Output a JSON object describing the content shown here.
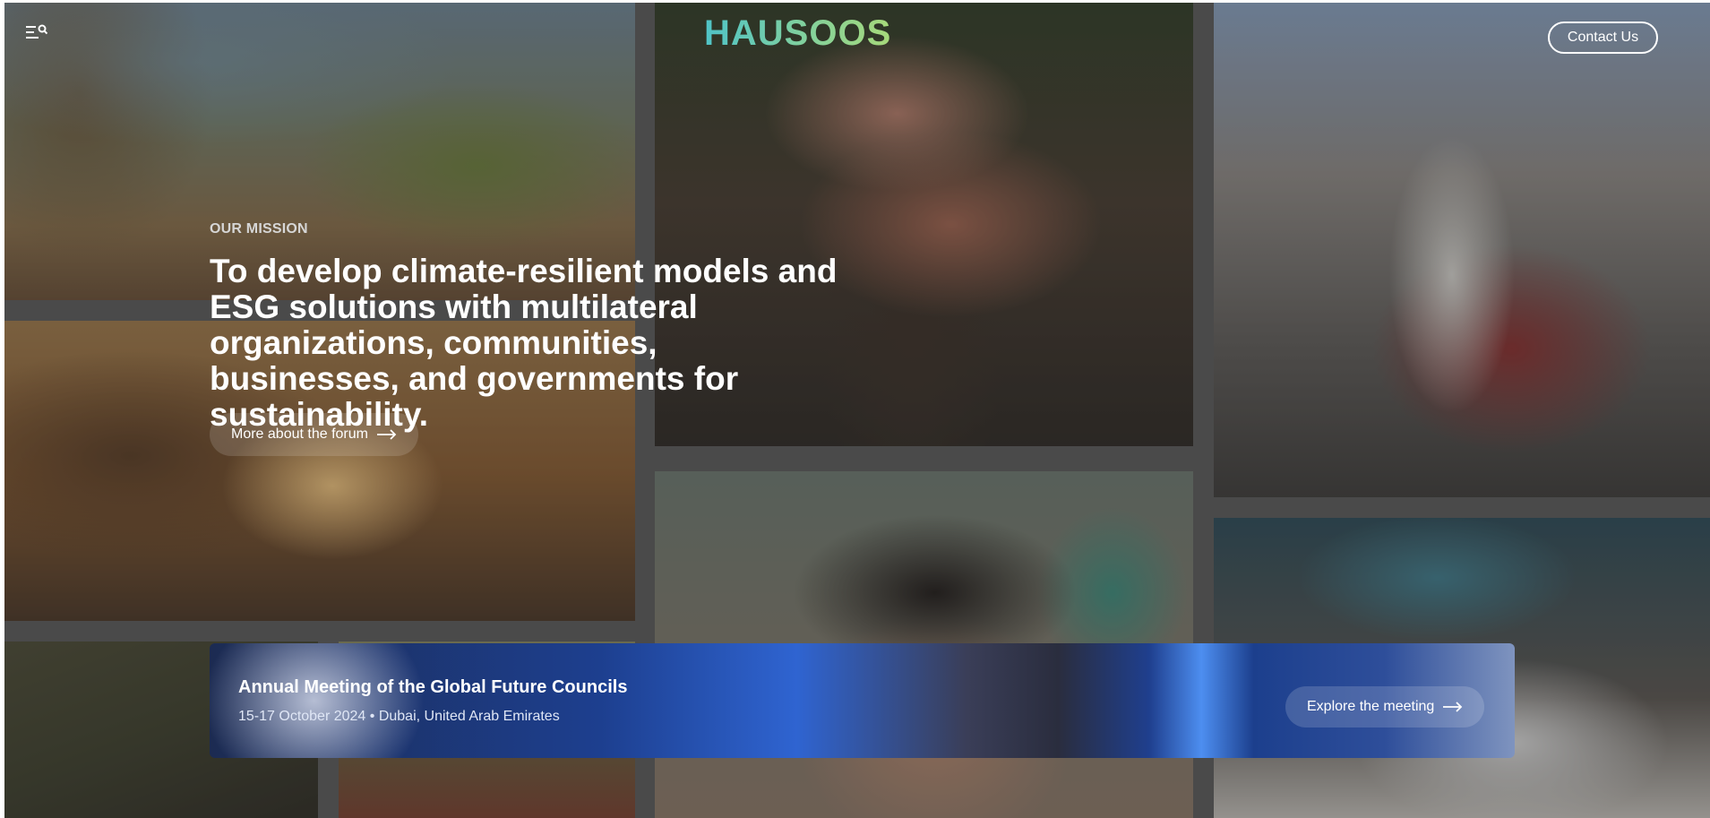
{
  "header": {
    "brand": "HAUSOOS",
    "contact_label": "Contact Us",
    "menu_icon": "menu-search-icon"
  },
  "mission": {
    "eyebrow": "OUR MISSION",
    "title": "To develop climate-resilient models and ESG solutions with multilateral organizations, communities, businesses, and governments for sustainability.",
    "cta_label": "More about the forum"
  },
  "event": {
    "title": "Annual Meeting of the Global Future Councils",
    "subtitle": "15-17 October 2024 • Dubai, United Arab Emirates",
    "cta_label": "Explore the meeting"
  },
  "colors": {
    "brand_gradient_start": "#4fc3c7",
    "brand_gradient_end": "#a7d97a",
    "banner_blue": "#2f64d1",
    "text": "#ffffff"
  }
}
